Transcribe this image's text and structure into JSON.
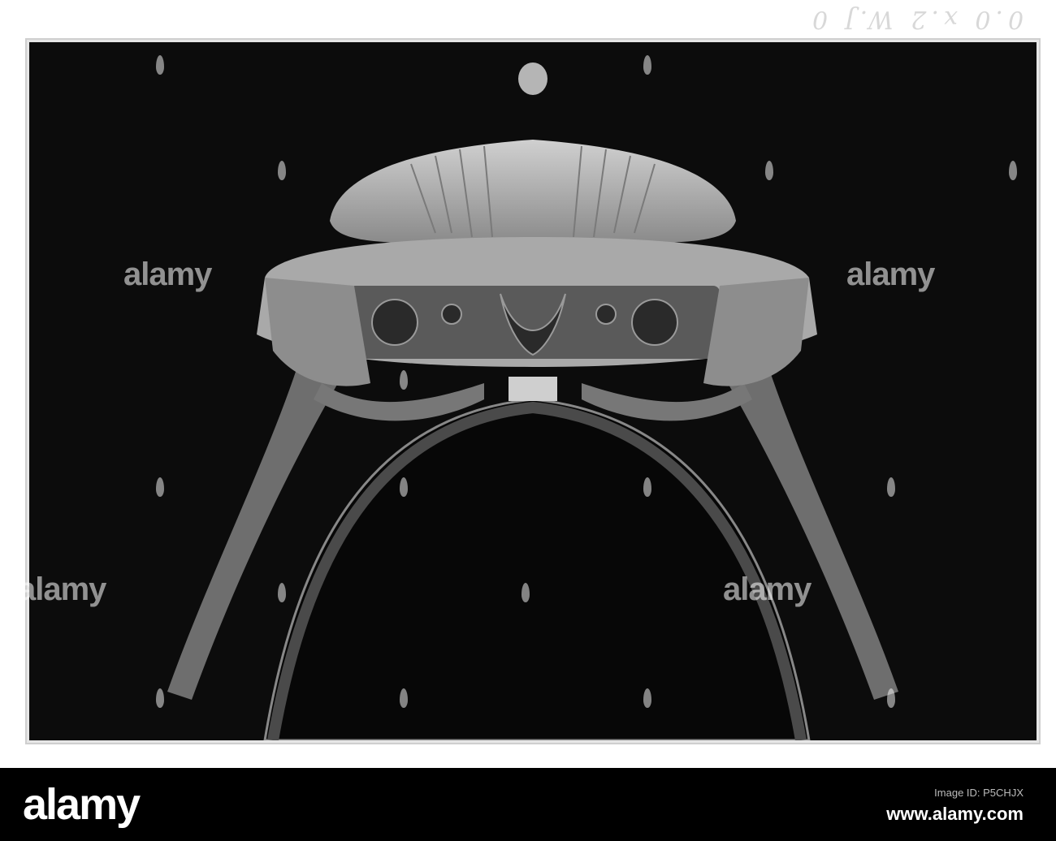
{
  "image": {
    "plate_mark": "0.0 x.2 W.J 0",
    "watermark": "alamy"
  },
  "footer": {
    "logo": "alamy",
    "label": "Image ID: P5CHJX",
    "url": "www.alamy.com"
  },
  "colors": {
    "background": "#0c0c0c",
    "footer": "#000000",
    "subject": "#bdbdbd"
  }
}
